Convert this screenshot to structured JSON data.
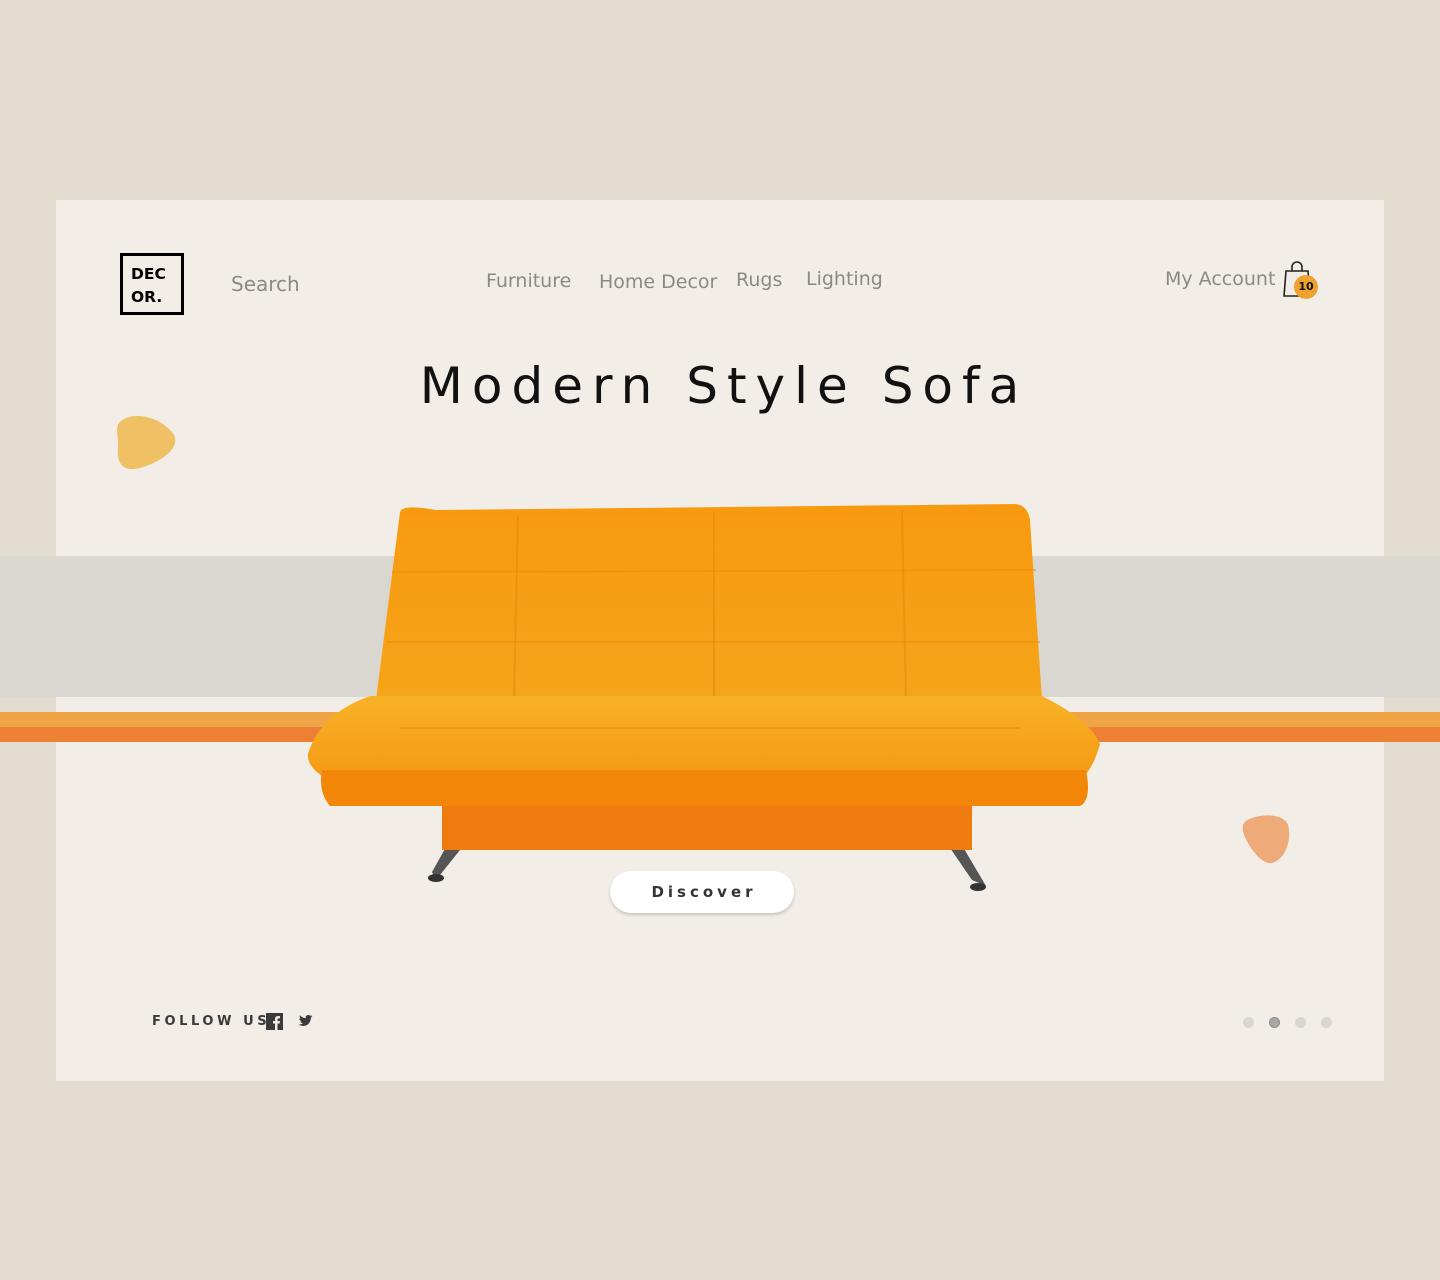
{
  "brand": {
    "logo_line1": "DEC",
    "logo_line2": "OR."
  },
  "search": {
    "placeholder": "Search"
  },
  "nav": {
    "items": [
      {
        "label": "Furniture"
      },
      {
        "label": "Home Decor"
      },
      {
        "label": "Rugs"
      },
      {
        "label": "Lighting"
      }
    ]
  },
  "header": {
    "account_label": "My Account",
    "cart_count": "10",
    "cart_icon": "shopping-bag-icon"
  },
  "hero": {
    "title": "Modern Style Sofa",
    "cta_label": "Discover",
    "image": "orange-sofa"
  },
  "footer": {
    "follow_label": "FOLLOW US",
    "social": [
      {
        "icon": "facebook-icon"
      },
      {
        "icon": "twitter-icon"
      }
    ]
  },
  "pagination": {
    "total": 4,
    "active_index": 1
  },
  "colors": {
    "page_bg": "#e2dbcf",
    "card_bg": "#f2eee7",
    "accent_yellow": "#efa446",
    "accent_orange": "#ee8035",
    "sofa_orange": "#f5920c"
  }
}
